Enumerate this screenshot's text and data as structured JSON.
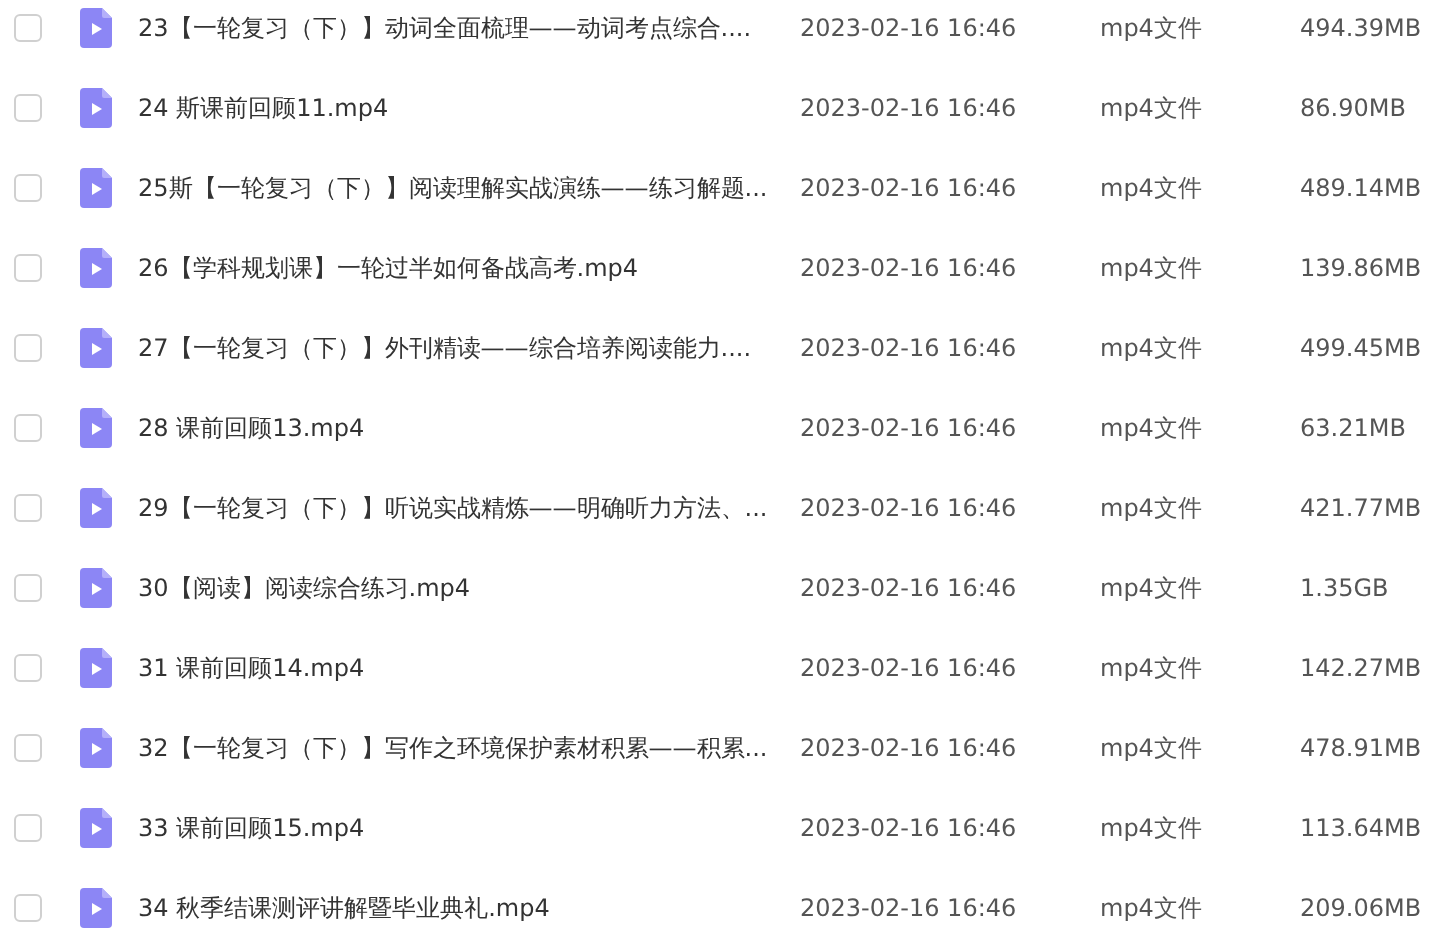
{
  "files": [
    {
      "name": "23【一轮复习（下）】动词全面梳理——动词考点综合....",
      "modified": "2023-02-16 16:46",
      "type": "mp4文件",
      "size": "494.39MB",
      "checked": false
    },
    {
      "name": "24 斯课前回顾11.mp4",
      "modified": "2023-02-16 16:46",
      "type": "mp4文件",
      "size": "86.90MB",
      "checked": false
    },
    {
      "name": "25斯【一轮复习（下）】阅读理解实战演练——练习解题...",
      "modified": "2023-02-16 16:46",
      "type": "mp4文件",
      "size": "489.14MB",
      "checked": false
    },
    {
      "name": "26【学科规划课】一轮过半如何备战高考.mp4",
      "modified": "2023-02-16 16:46",
      "type": "mp4文件",
      "size": "139.86MB",
      "checked": false
    },
    {
      "name": "27【一轮复习（下）】外刊精读——综合培养阅读能力....",
      "modified": "2023-02-16 16:46",
      "type": "mp4文件",
      "size": "499.45MB",
      "checked": false
    },
    {
      "name": "28 课前回顾13.mp4",
      "modified": "2023-02-16 16:46",
      "type": "mp4文件",
      "size": "63.21MB",
      "checked": false
    },
    {
      "name": "29【一轮复习（下）】听说实战精炼——明确听力方法、...",
      "modified": "2023-02-16 16:46",
      "type": "mp4文件",
      "size": "421.77MB",
      "checked": false
    },
    {
      "name": "30【阅读】阅读综合练习.mp4",
      "modified": "2023-02-16 16:46",
      "type": "mp4文件",
      "size": "1.35GB",
      "checked": false
    },
    {
      "name": "31 课前回顾14.mp4",
      "modified": "2023-02-16 16:46",
      "type": "mp4文件",
      "size": "142.27MB",
      "checked": false
    },
    {
      "name": "32【一轮复习（下）】写作之环境保护素材积累——积累...",
      "modified": "2023-02-16 16:46",
      "type": "mp4文件",
      "size": "478.91MB",
      "checked": false
    },
    {
      "name": "33 课前回顾15.mp4",
      "modified": "2023-02-16 16:46",
      "type": "mp4文件",
      "size": "113.64MB",
      "checked": false
    },
    {
      "name": "34 秋季结课测评讲解暨毕业典礼.mp4",
      "modified": "2023-02-16 16:46",
      "type": "mp4文件",
      "size": "209.06MB",
      "checked": false
    }
  ]
}
